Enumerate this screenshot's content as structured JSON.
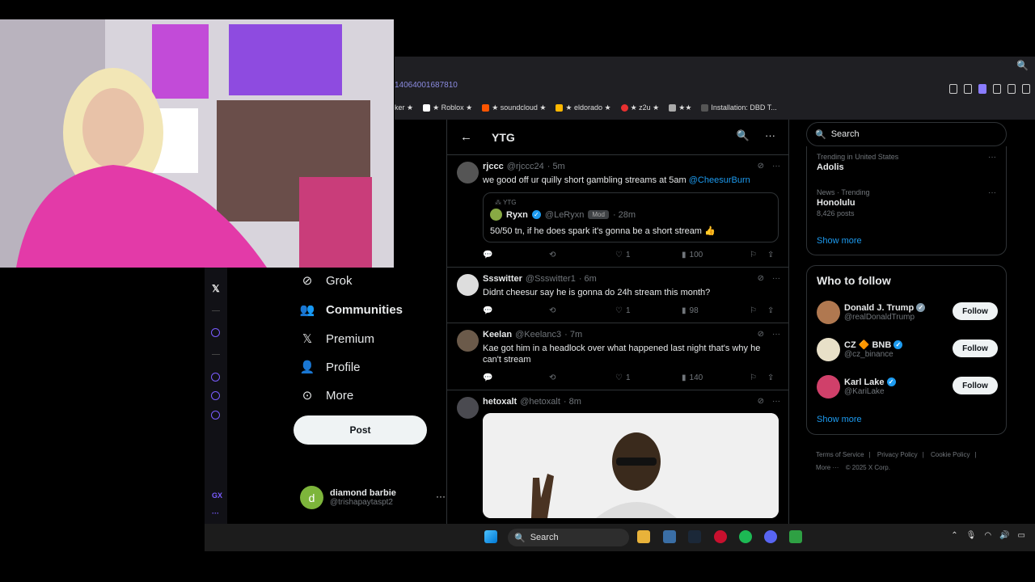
{
  "browser": {
    "address_fragment": "14064001687810",
    "bookmarks": [
      {
        "label": "ker ★",
        "color": ""
      },
      {
        "label": "★ Roblox ★",
        "color": "#ffffff"
      },
      {
        "label": "★ soundcloud ★",
        "color": "#ff5500"
      },
      {
        "label": "★ eldorado ★",
        "color": "#ffb800"
      },
      {
        "label": "★ z2u ★",
        "color": "#e83030"
      },
      {
        "label": "★★",
        "color": "#aaaaaa"
      },
      {
        "label": "Installation: DBD T...",
        "color": "#888888"
      }
    ]
  },
  "nav": {
    "items": [
      {
        "label": "Grok",
        "icon": "grok-icon"
      },
      {
        "label": "Communities",
        "icon": "communities-icon"
      },
      {
        "label": "Premium",
        "icon": "x-logo-icon"
      },
      {
        "label": "Profile",
        "icon": "profile-icon"
      },
      {
        "label": "More",
        "icon": "more-circle-icon"
      }
    ],
    "post_label": "Post",
    "account": {
      "initial": "d",
      "name": "diamond barbie",
      "handle": "@trishapaytaspt2"
    }
  },
  "feed": {
    "title": "YTG",
    "tweets": [
      {
        "name": "rjccc",
        "handle": "@rjccc24",
        "time": "· 5m",
        "text": "we good off ur quilly short gambling streams at 5am ",
        "mention": "@CheesurBurn",
        "quote": {
          "context": "YTG",
          "name": "Ryxn",
          "handle": "@LeRyxn",
          "badge": "Mod",
          "time": "· 28m",
          "text": "50/50 tn, if he does spark it's gonna be a short stream 👍"
        },
        "likes": "1",
        "views": "100"
      },
      {
        "name": "Ssswitter",
        "handle": "@Ssswitter1",
        "time": "· 6m",
        "text": "Didnt cheesur say he is gonna do 24h stream this month?",
        "likes": "1",
        "views": "98"
      },
      {
        "name": "Keelan",
        "handle": "@Keelanc3",
        "time": "· 7m",
        "text": "Kae got him in a headlock over what happened last night that's why he can't stream",
        "likes": "1",
        "views": "140"
      },
      {
        "name": "hetoxalt",
        "handle": "@hetoxalt",
        "time": "· 8m"
      }
    ]
  },
  "sidebar": {
    "search_placeholder": "Search",
    "trends": [
      {
        "context": "Trending in United States",
        "name": "Adolis",
        "count": ""
      },
      {
        "context": "News · Trending",
        "name": "Honolulu",
        "count": "8,426 posts"
      }
    ],
    "show_more": "Show more",
    "who_to_follow": {
      "title": "Who to follow",
      "people": [
        {
          "name": "Donald J. Trump",
          "handle": "@realDonaldTrump",
          "color": "#b07850"
        },
        {
          "name": "CZ 🔶 BNB",
          "handle": "@cz_binance",
          "color": "#e8e0c8"
        },
        {
          "name": "Karl Lake",
          "handle": "@KariLake",
          "color": "#d0406a"
        }
      ],
      "follow_label": "Follow",
      "show_more": "Show more"
    },
    "footer": [
      "Terms of Service",
      "|",
      "Privacy Policy",
      "|",
      "Cookie Policy",
      "|",
      "More ···",
      "© 2025 X Corp."
    ]
  },
  "taskbar": {
    "search_label": "Search"
  },
  "colors": {
    "accent": "#1d9bf0",
    "background": "#000000",
    "border": "#2f3336"
  }
}
